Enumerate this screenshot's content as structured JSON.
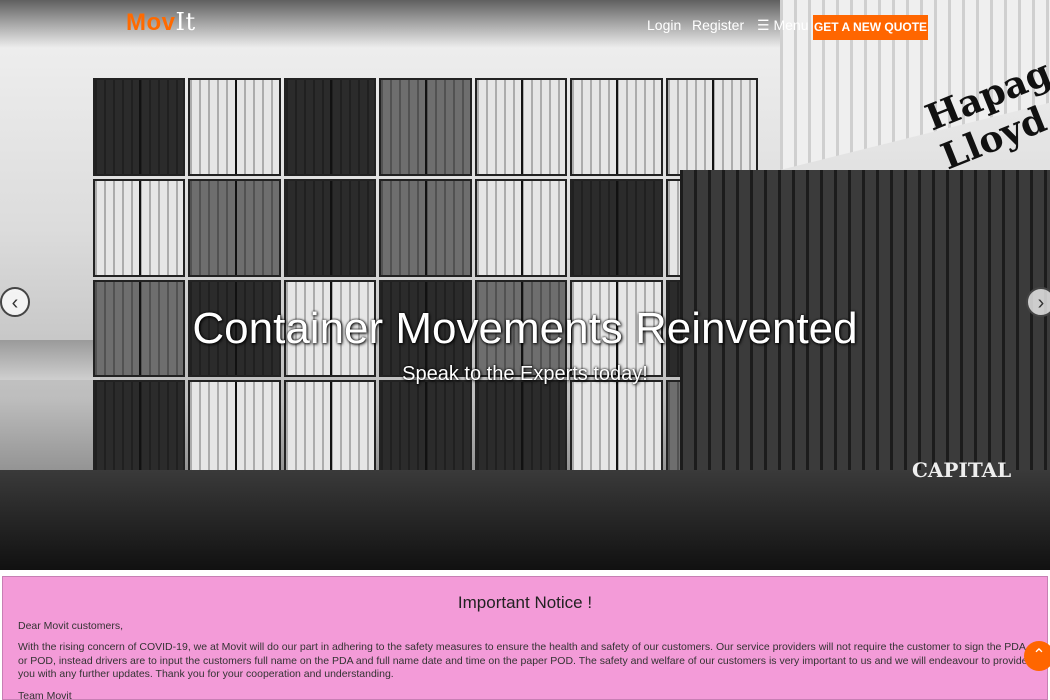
{
  "nav": {
    "logo_prefix": "Mov",
    "logo_suffix": "It",
    "login": "Login",
    "register": "Register",
    "menu_icon": "hamburger-icon",
    "menu": "Menu",
    "quote_button": "GET A NEW QUOTE"
  },
  "hero": {
    "title": "Container Movements Reinvented",
    "subtitle": "Speak to the Experts today!",
    "prev_icon": "chevron-left-icon",
    "next_icon": "chevron-right-icon",
    "container_print_1": "Hapag-Lloyd",
    "container_print_2": "CAPITAL"
  },
  "notice": {
    "heading": "Important Notice !",
    "greeting": "Dear Movit customers,",
    "body": "With the rising concern of COVID-19, we at Movit will do our part in adhering to the safety measures to ensure the health and safety of our customers. Our service providers will not require the customer to sign the PDA or POD, instead drivers are to input the customers full name on the PDA and full name date and time on the paper POD. The safety and welfare of our customers is very important to us and we will endeavour to provide you with any further updates. Thank you for your cooperation and understanding.",
    "signoff": "Team Movit"
  },
  "scroll_top_icon": "chevron-up-icon",
  "colors": {
    "accent": "#ff6600",
    "notice_bg": "#f39bd8"
  }
}
